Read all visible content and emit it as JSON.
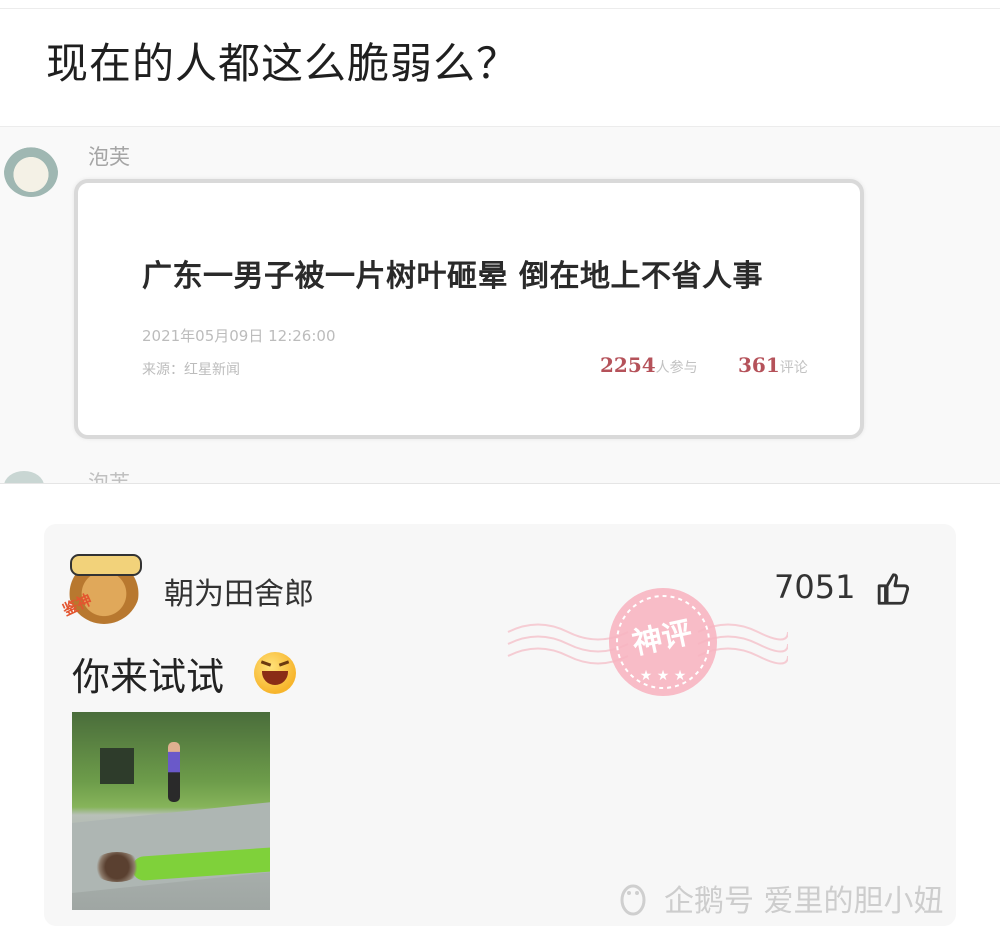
{
  "post": {
    "title": "现在的人都这么脆弱么？"
  },
  "embed": {
    "username": "泡芙",
    "username_next": "泡芙",
    "news": {
      "headline": "广东一男子被一片树叶砸晕 倒在地上不省人事",
      "date": "2021年05月09日 12:26:00",
      "source": "来源：红星新闻",
      "participants_count": "2254",
      "participants_label": "人参与",
      "comments_count": "361",
      "comments_label": "评论"
    }
  },
  "comment": {
    "username": "朝为田舍郎",
    "avatar_tag": "鉴神",
    "likes": "7051",
    "text": "你来试试",
    "stamp_label": "神评",
    "icons": {
      "like": "thumbs-up-icon",
      "emoji": "laughing-emoji-icon",
      "stamp": "god-comment-stamp-icon"
    }
  },
  "watermark": {
    "text": "企鹅号 爱里的胆小妞",
    "icon": "penguin-icon"
  },
  "colors": {
    "stamp": "#f3a6b4",
    "stat_number": "#b5525a",
    "card_bg": "#f7f7f7"
  }
}
